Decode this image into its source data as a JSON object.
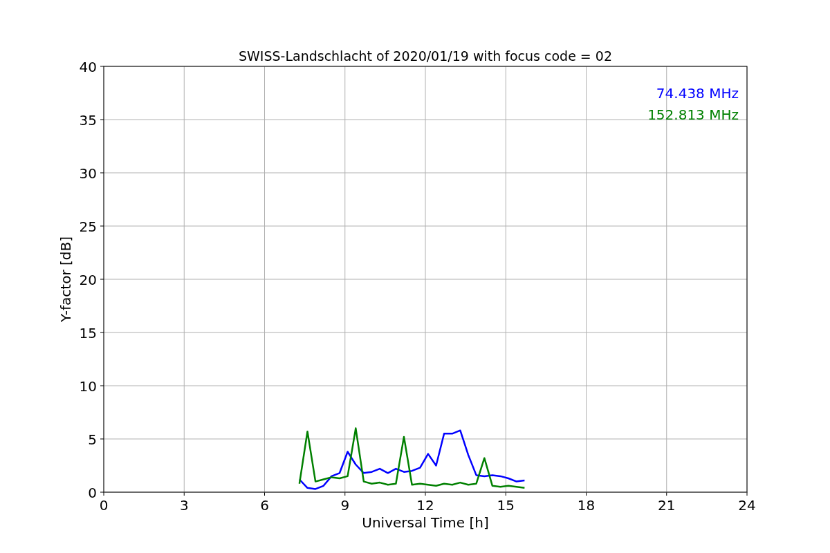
{
  "figure": {
    "chart_data": {
      "type": "line",
      "title": "SWISS-Landschlacht of 2020/01/19 with focus code = 02",
      "xlabel": "Universal Time [h]",
      "ylabel": "Y-factor [dB]",
      "x": [
        7.3,
        7.6,
        7.9,
        8.2,
        8.5,
        8.8,
        9.1,
        9.4,
        9.7,
        10.0,
        10.3,
        10.6,
        10.9,
        11.2,
        11.5,
        11.8,
        12.1,
        12.4,
        12.7,
        13.0,
        13.3,
        13.6,
        13.9,
        14.2,
        14.5,
        14.8,
        15.1,
        15.4,
        15.7
      ],
      "series": [
        {
          "name": "74.438 MHz",
          "color": "#0000ff",
          "values": [
            1.2,
            0.4,
            0.3,
            0.6,
            1.5,
            1.8,
            3.8,
            2.6,
            1.8,
            1.9,
            2.2,
            1.8,
            2.2,
            1.9,
            2.0,
            2.3,
            3.6,
            2.5,
            5.5,
            5.5,
            5.8,
            3.5,
            1.6,
            1.5,
            1.6,
            1.5,
            1.3,
            1.0,
            1.1
          ]
        },
        {
          "name": "152.813 MHz",
          "color": "#008000",
          "values": [
            0.8,
            5.7,
            1.0,
            1.2,
            1.4,
            1.3,
            1.5,
            6.0,
            1.0,
            0.8,
            0.9,
            0.7,
            0.8,
            5.2,
            0.7,
            0.8,
            0.7,
            0.6,
            0.8,
            0.7,
            0.9,
            0.7,
            0.8,
            3.2,
            0.6,
            0.5,
            0.6,
            0.5,
            0.4
          ]
        }
      ],
      "xlim": [
        0,
        24
      ],
      "grid": true,
      "ylim": [
        0,
        40
      ],
      "xticks": [
        0,
        3,
        6,
        9,
        12,
        15,
        18,
        21,
        24
      ],
      "yticks": [
        0,
        5,
        10,
        15,
        20,
        25,
        30,
        35,
        40
      ]
    }
  }
}
